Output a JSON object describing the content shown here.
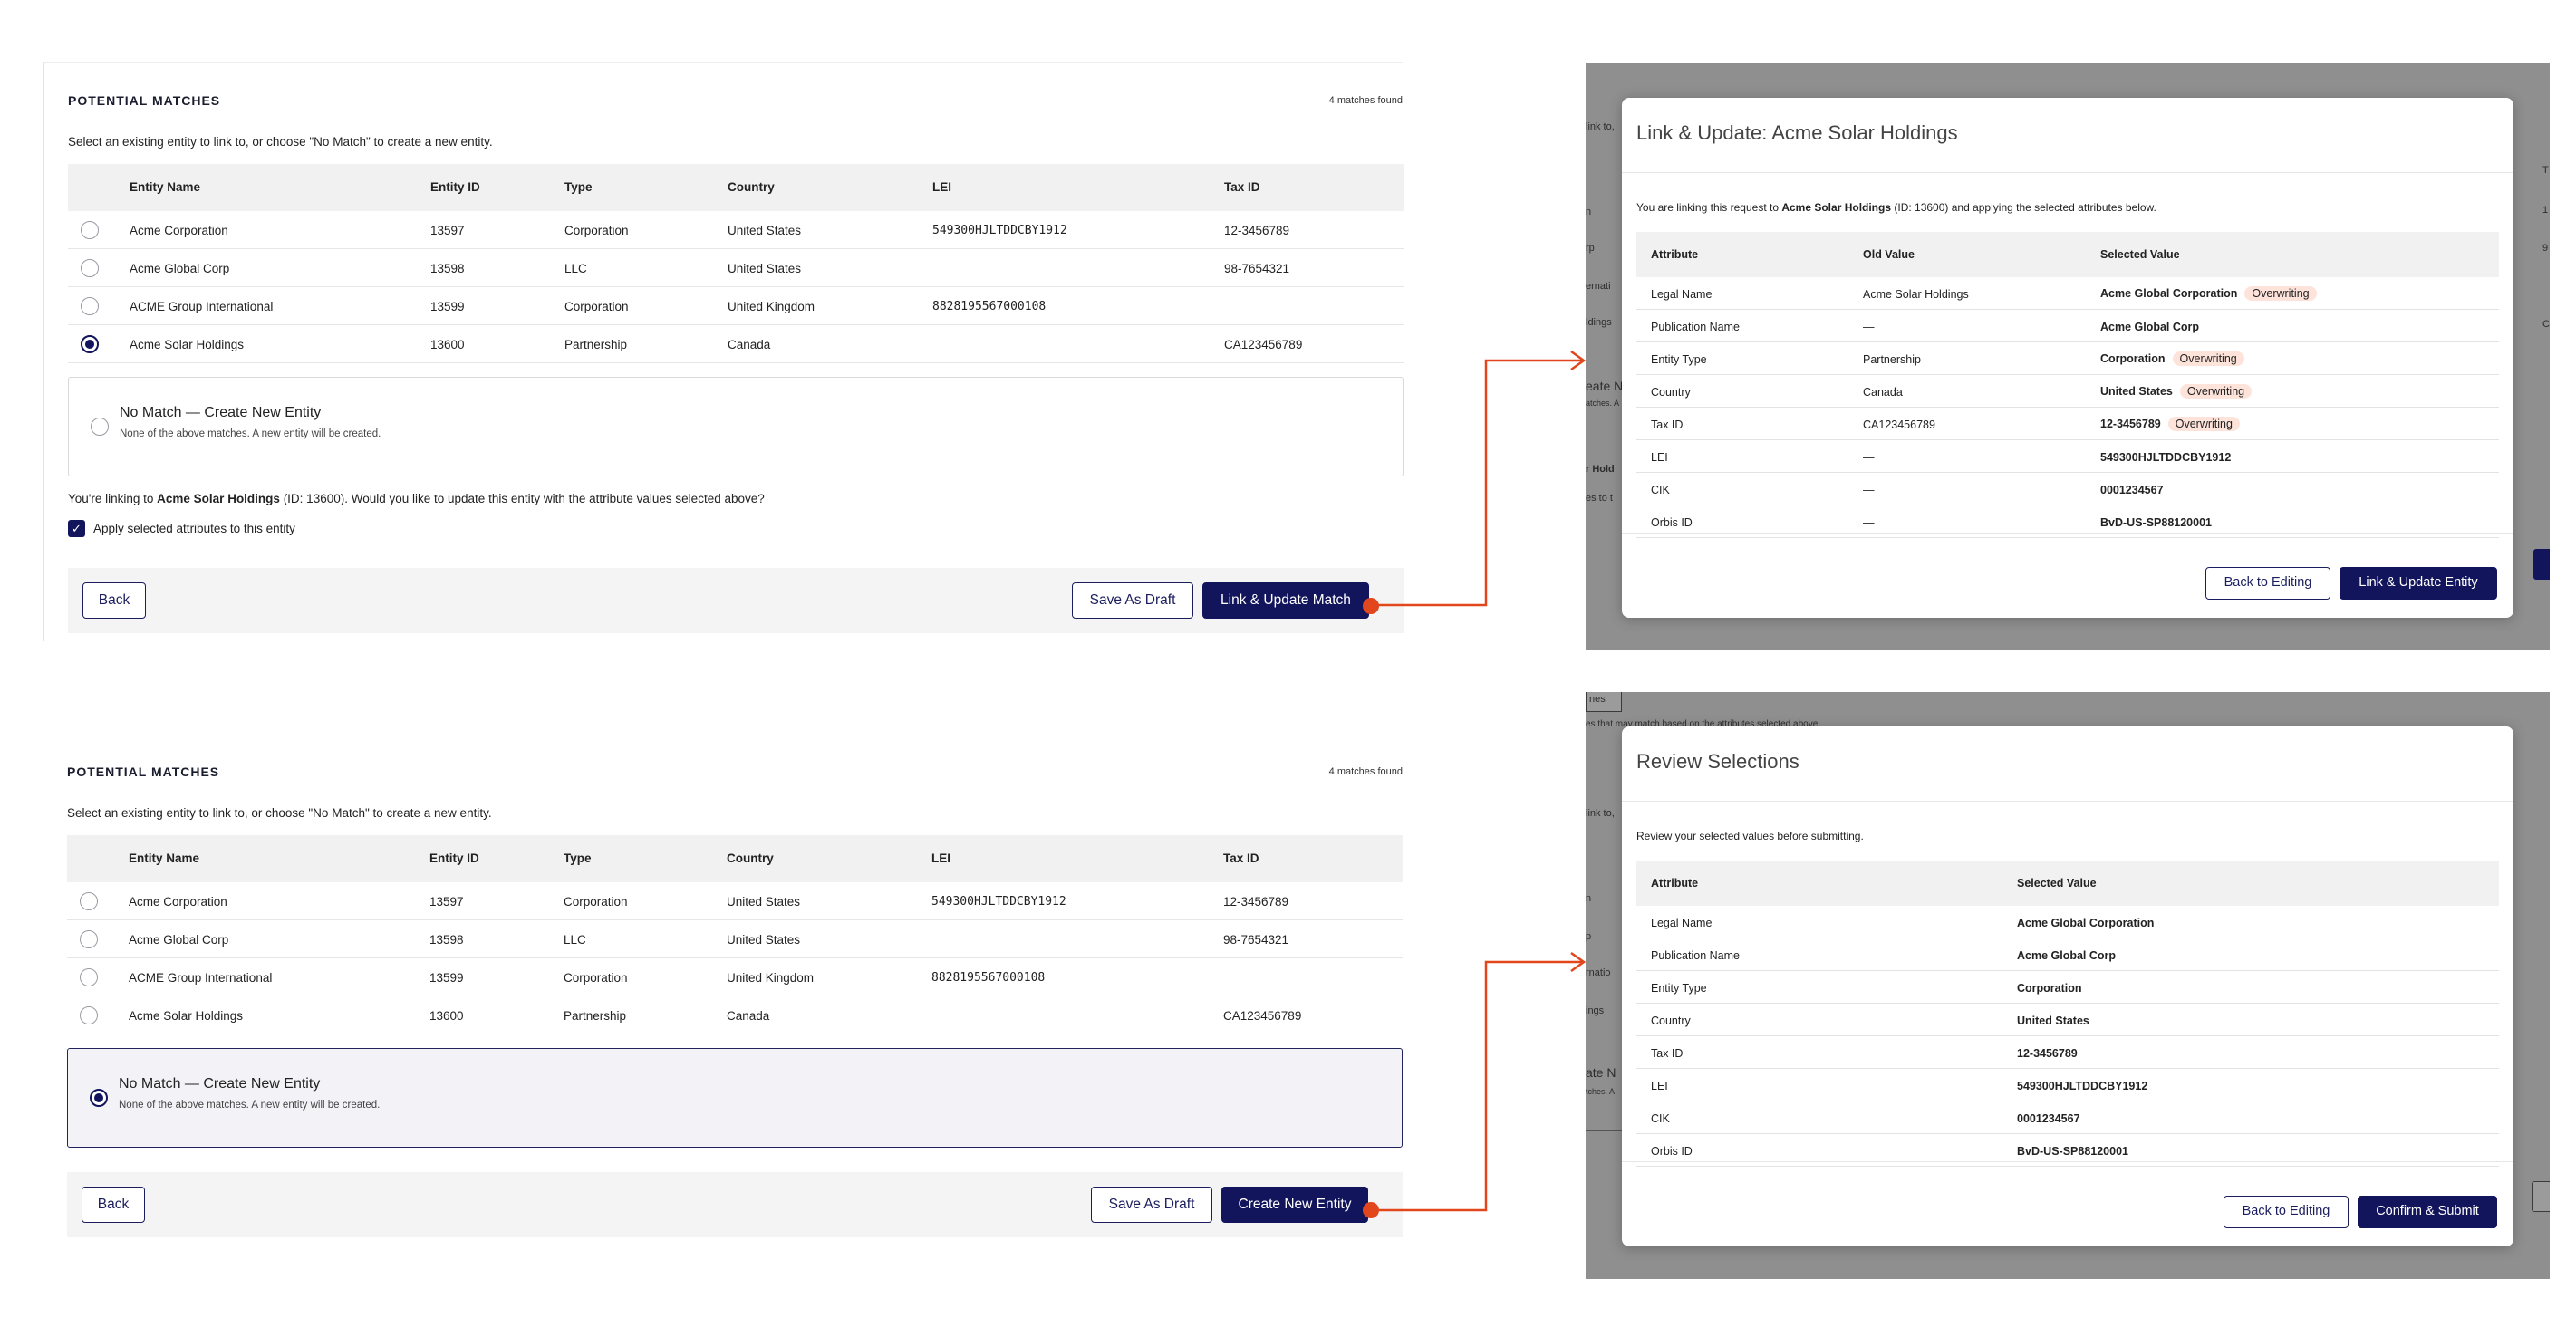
{
  "colors": {
    "primary": "#12155b",
    "accent_arrow": "#e2461d",
    "overwrite_pill": "#fde3da"
  },
  "matches": {
    "heading": "POTENTIAL MATCHES",
    "count": "4 matches found",
    "description": "Select an existing entity to link to, or choose \"No Match\" to create a new entity.",
    "columns": [
      "Entity Name",
      "Entity ID",
      "Type",
      "Country",
      "LEI",
      "Tax ID"
    ],
    "rows": [
      {
        "name": "Acme Corporation",
        "id": "13597",
        "type": "Corporation",
        "country": "United States",
        "lei": "549300HJLTDDCBY1912",
        "tax": "12-3456789"
      },
      {
        "name": "Acme Global Corp",
        "id": "13598",
        "type": "LLC",
        "country": "United States",
        "lei": "",
        "tax": "98-7654321"
      },
      {
        "name": "ACME Group International",
        "id": "13599",
        "type": "Corporation",
        "country": "United Kingdom",
        "lei": "8828195567000108",
        "tax": ""
      },
      {
        "name": "Acme Solar Holdings",
        "id": "13600",
        "type": "Partnership",
        "country": "Canada",
        "lei": "",
        "tax": "CA123456789"
      }
    ],
    "no_match_title": "No Match — Create New Entity",
    "no_match_sub": "None of the above matches. A new entity will be created.",
    "link_msg_prefix": "You're linking to ",
    "link_msg_name": "Acme Solar Holdings",
    "link_msg_suffix": " (ID: 13600). Would you like to update this entity with the attribute values selected above?",
    "checkbox_label": "Apply selected attributes to this entity",
    "back": "Back",
    "save_draft": "Save As Draft",
    "link_update": "Link & Update Match",
    "create_new": "Create New Entity"
  },
  "link_modal": {
    "title": "Link & Update: Acme Solar Holdings",
    "desc_prefix": "You are linking this request to ",
    "desc_name": "Acme Solar Holdings",
    "desc_suffix": " (ID: 13600) and applying the selected attributes below.",
    "columns": [
      "Attribute",
      "Old Value",
      "Selected Value"
    ],
    "overwriting": "Overwriting",
    "rows": [
      {
        "attr": "Legal Name",
        "old": "Acme Solar Holdings",
        "new": "Acme Global Corporation",
        "ow": true
      },
      {
        "attr": "Publication Name",
        "old": "—",
        "new": "Acme Global Corp",
        "ow": false
      },
      {
        "attr": "Entity Type",
        "old": "Partnership",
        "new": "Corporation",
        "ow": true
      },
      {
        "attr": "Country",
        "old": "Canada",
        "new": "United States",
        "ow": true
      },
      {
        "attr": "Tax ID",
        "old": "CA123456789",
        "new": "12-3456789",
        "ow": true
      },
      {
        "attr": "LEI",
        "old": "—",
        "new": "549300HJLTDDCBY1912",
        "ow": false
      },
      {
        "attr": "CIK",
        "old": "—",
        "new": "0001234567",
        "ow": false
      },
      {
        "attr": "Orbis ID",
        "old": "—",
        "new": "BvD-US-SP88120001",
        "ow": false
      }
    ],
    "back": "Back to Editing",
    "confirm": "Link & Update Entity"
  },
  "review_modal": {
    "title": "Review Selections",
    "desc": "Review your selected values before submitting.",
    "columns": [
      "Attribute",
      "Selected Value"
    ],
    "rows": [
      {
        "attr": "Legal Name",
        "new": "Acme Global Corporation"
      },
      {
        "attr": "Publication Name",
        "new": "Acme Global Corp"
      },
      {
        "attr": "Entity Type",
        "new": "Corporation"
      },
      {
        "attr": "Country",
        "new": "United States"
      },
      {
        "attr": "Tax ID",
        "new": "12-3456789"
      },
      {
        "attr": "LEI",
        "new": "549300HJLTDDCBY1912"
      },
      {
        "attr": "CIK",
        "new": "0001234567"
      },
      {
        "attr": "Orbis ID",
        "new": "BvD-US-SP88120001"
      }
    ],
    "back": "Back to Editing",
    "confirm": "Confirm & Submit"
  },
  "backdrop_fragments": {
    "top": [
      "link to,",
      "n",
      "rp",
      "ernati",
      "ldings",
      "eate N",
      "atches. A",
      "r Hold",
      "es to t"
    ],
    "top_right": [
      "T",
      "1",
      "9",
      "C"
    ],
    "bottom": [
      "nes",
      "es that may match based on the attributes selected above.",
      "link to,",
      "n",
      "p",
      "rnatio",
      "ings",
      "ate N",
      "tches. A"
    ]
  }
}
